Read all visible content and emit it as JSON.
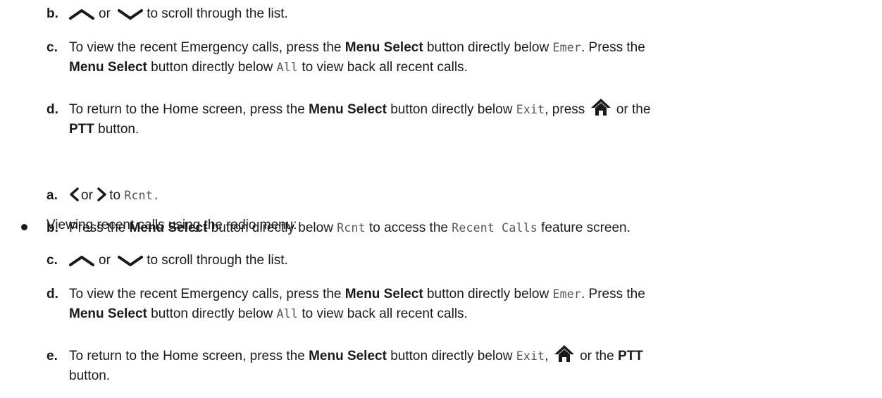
{
  "sections": {
    "part1": {
      "b": {
        "letter": "b.",
        "or": "or",
        "tail": "to scroll through the list."
      },
      "c": {
        "letter": "c.",
        "t1": "To view the recent Emergency calls, press the ",
        "menu1": "Menu Select",
        "t2": " button directly below ",
        "code1": "Emer",
        "t3": ". Press the",
        "menu2": "Menu Select",
        "t4": " button directly below ",
        "code2": "All",
        "t5": " to view back all recent calls."
      },
      "d": {
        "letter": "d.",
        "t1": "To return to the Home screen, press the ",
        "menu": "Menu Select",
        "t2": " button directly below ",
        "code": "Exit",
        "t3": ", press ",
        "t4": " or the",
        "ptt": "PTT",
        "t5": " button."
      }
    },
    "bullet": {
      "text": "Viewing recent calls using the radio menu:"
    },
    "part2": {
      "a": {
        "letter": "a.",
        "or": "or",
        "to": "to",
        "code": "Rcnt."
      },
      "b": {
        "letter": "b.",
        "t1": "Press the ",
        "menu": "Menu Select",
        "t2": " button directly below ",
        "code1": "Rcnt",
        "t3": " to access the ",
        "code2": "Recent Calls",
        "t4": " feature screen."
      },
      "c": {
        "letter": "c.",
        "or": "or",
        "tail": "to scroll through the list."
      },
      "d": {
        "letter": "d.",
        "t1": "To view the recent Emergency calls, press the ",
        "menu1": "Menu Select",
        "t2": " button directly below ",
        "code1": "Emer",
        "t3": ". Press the",
        "menu2": "Menu Select",
        "t4": " button directly below ",
        "code2": "All",
        "t5": " to view back all recent calls."
      },
      "e": {
        "letter": "e.",
        "t1": "To return to the Home screen, press the ",
        "menu": "Menu Select",
        "t2": " button directly below ",
        "code": "Exit",
        "t3": ", ",
        "t4": " or the ",
        "ptt": "PTT",
        "t5": "button."
      }
    }
  },
  "icons": {
    "up": "chevron-up-icon",
    "down": "chevron-down-icon",
    "left": "chevron-left-icon",
    "right": "chevron-right-icon",
    "home": "home-icon"
  },
  "colors": {
    "text": "#1a1a1a",
    "code": "#555555"
  }
}
